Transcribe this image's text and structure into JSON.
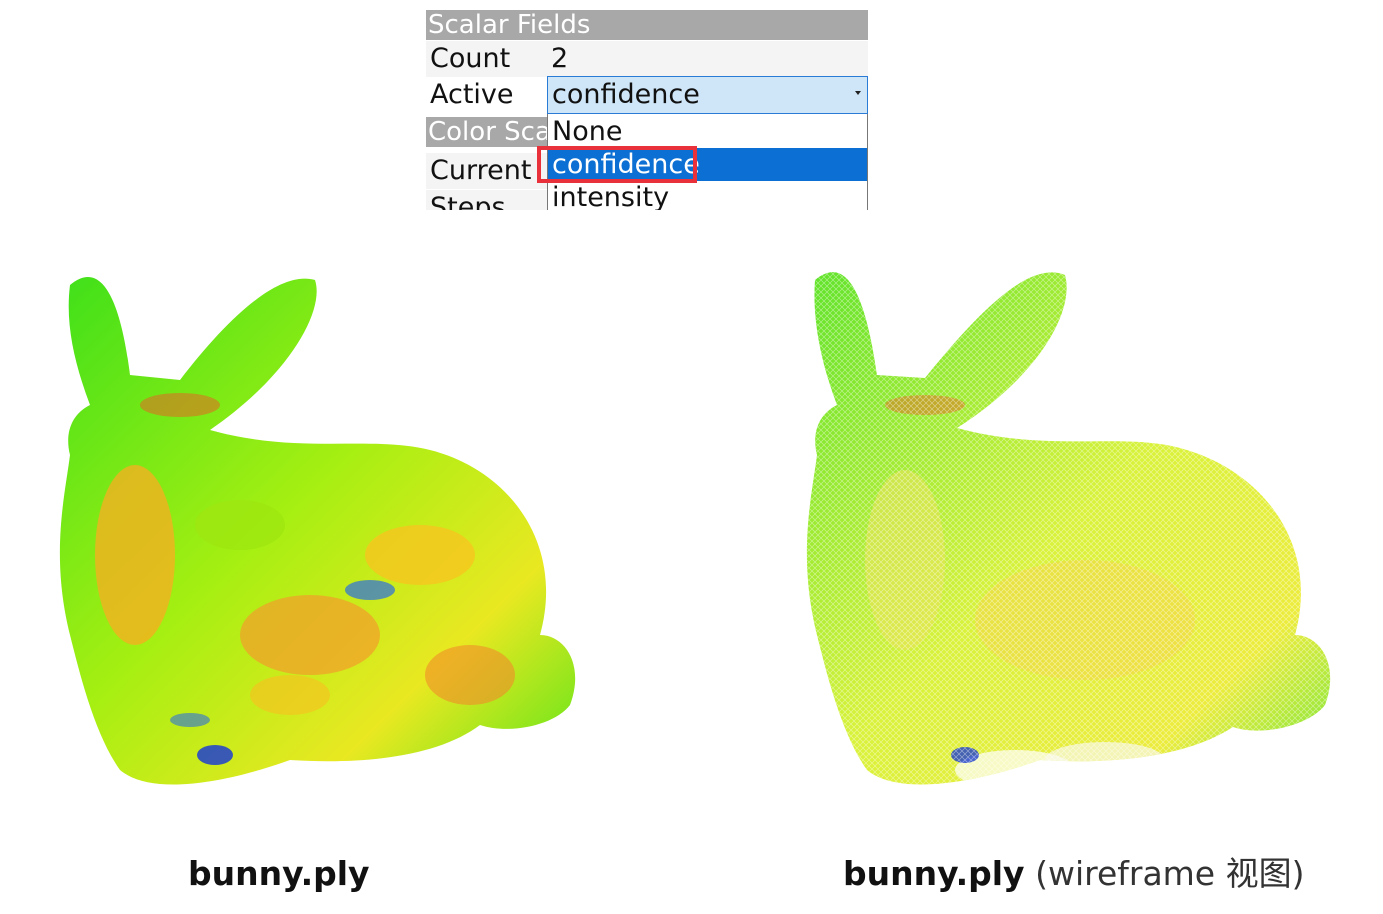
{
  "panel": {
    "scalar_fields_header": "Scalar Fields",
    "count_label": "Count",
    "count_value": "2",
    "active_label": "Active",
    "active_value": "confidence",
    "color_scale_header": "Color Scal",
    "current_label": "Current",
    "steps_label": "Steps",
    "dropdown_options": [
      "None",
      "confidence",
      "intensity"
    ],
    "dropdown_selected": "confidence"
  },
  "captions": {
    "left_name": "bunny.ply",
    "right_name": "bunny.ply",
    "right_suffix": "(wireframe  视图)"
  },
  "colors": {
    "highlight": "#e8313a",
    "selection": "#0b6fd3",
    "combo_bg": "#cfe6f8",
    "header_bg": "#a8a8a8"
  }
}
